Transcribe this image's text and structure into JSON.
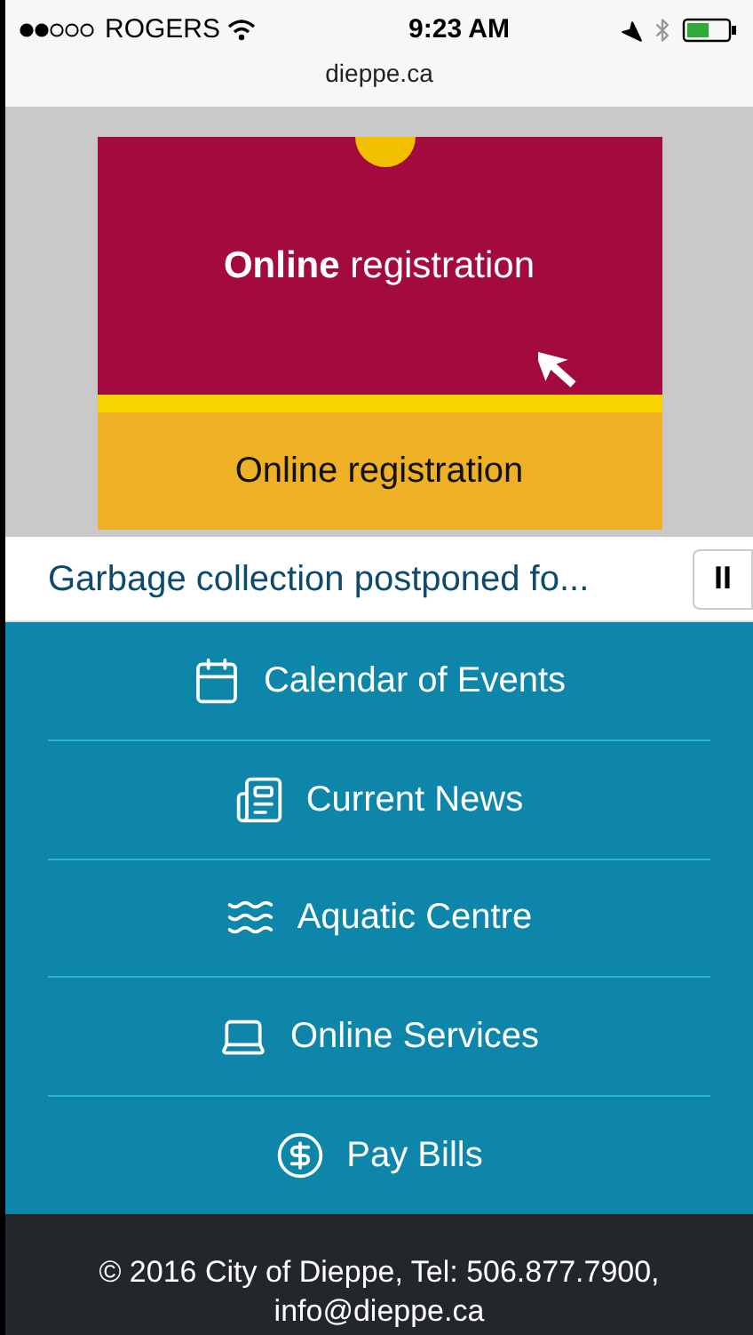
{
  "status_bar": {
    "carrier": "ROGERS",
    "time": "9:23 AM",
    "url": "dieppe.ca"
  },
  "banner": {
    "headline": "**Online** registration",
    "caption": "Online registration"
  },
  "ticker": {
    "text": "Garbage collection postponed fo...",
    "button": "II"
  },
  "menu": [
    {
      "label": "Calendar of Events",
      "kind": "calendar"
    },
    {
      "label": "Current News",
      "kind": "news"
    },
    {
      "label": "Aquatic Centre",
      "kind": "swim"
    },
    {
      "label": "Online Services",
      "kind": "laptop"
    },
    {
      "label": "Pay Bills",
      "kind": "dollar"
    }
  ],
  "footer": {
    "text": "© 2016 City of Dieppe, Tel: 506.877.7900, info@dieppe.ca"
  }
}
